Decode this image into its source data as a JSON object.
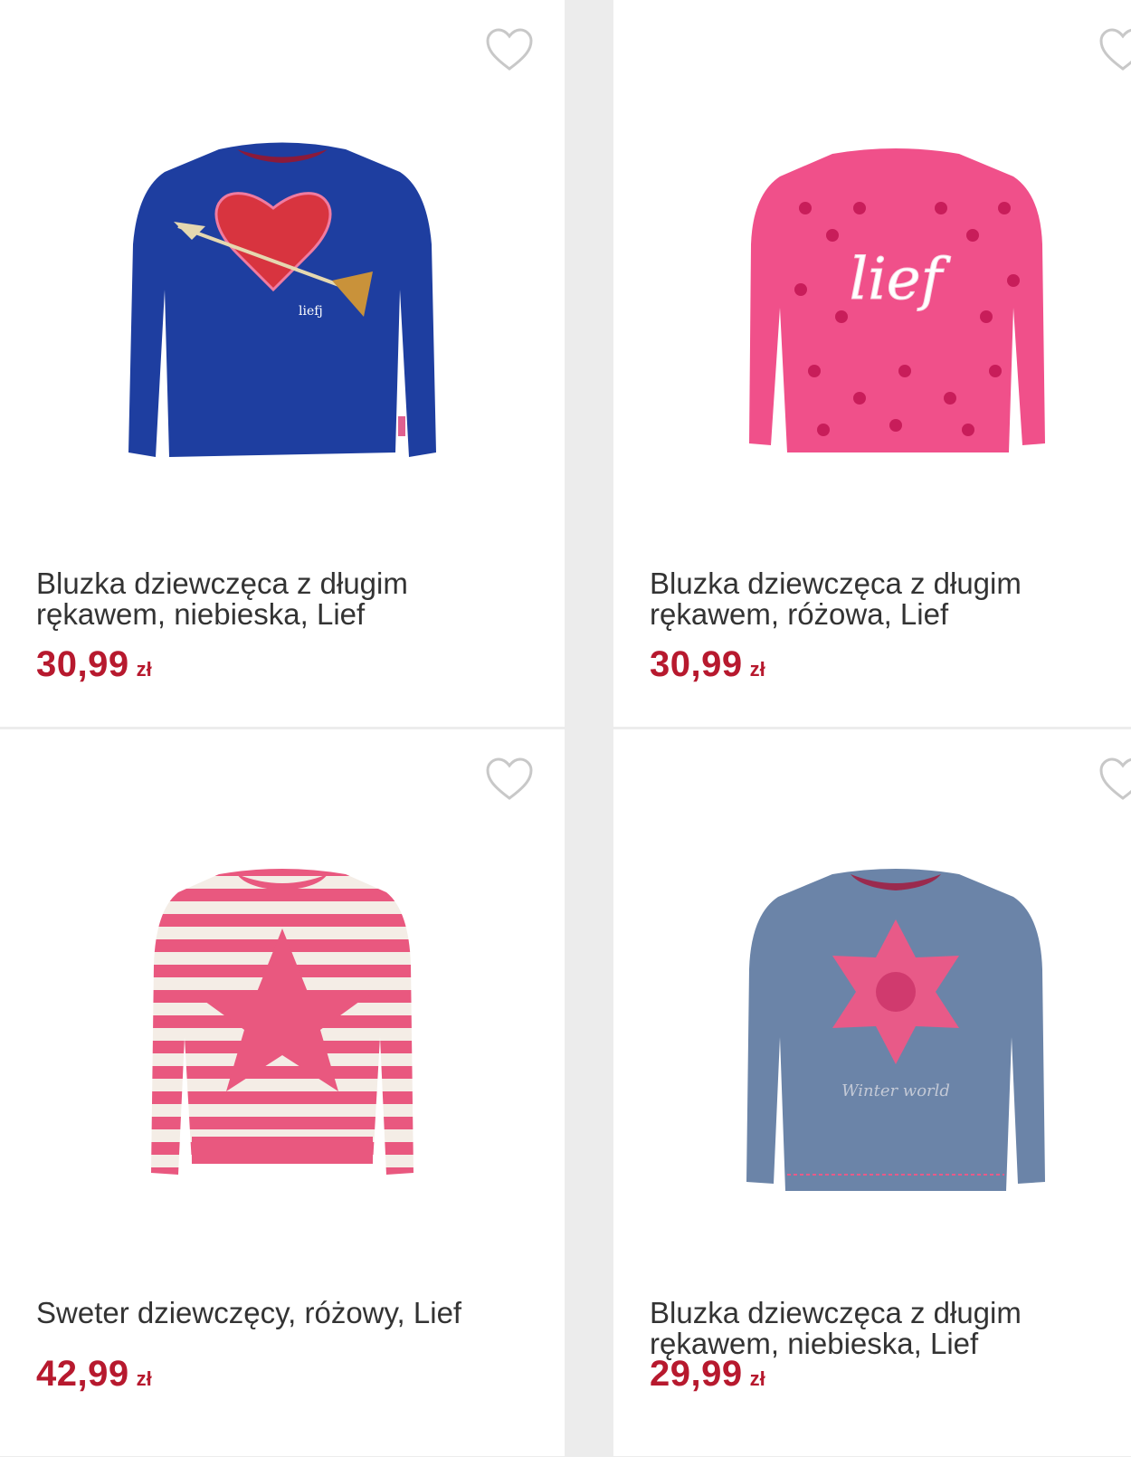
{
  "colors": {
    "price": "#b7192e",
    "title": "#333333",
    "background": "#ececec",
    "card": "#ffffff",
    "favorite_icon": "#c8c8c8"
  },
  "products": [
    {
      "title": "Bluzka dziewczęca z długim\nrękawem, niebieska, Lief",
      "price": "30,99",
      "currency": "zł",
      "icon": "blue-long-sleeve-top-with-heart-image",
      "print_text": "liefj"
    },
    {
      "title": "Bluzka dziewczęca z długim\nrękawem, różowa, Lief",
      "price": "30,99",
      "currency": "zł",
      "icon": "pink-long-sleeve-top-with-hearts-image",
      "print_text": "lief"
    },
    {
      "title": "Sweter dziewczęcy, różowy, Lief",
      "price": "42,99",
      "currency": "zł",
      "icon": "pink-striped-sweater-with-star-image"
    },
    {
      "title": "Bluzka dziewczęca z długim\nrękawem, niebieska, Lief",
      "price": "29,99",
      "currency": "zł",
      "icon": "grey-blue-top-with-snowflake-image",
      "print_text": "Winter world"
    }
  ]
}
